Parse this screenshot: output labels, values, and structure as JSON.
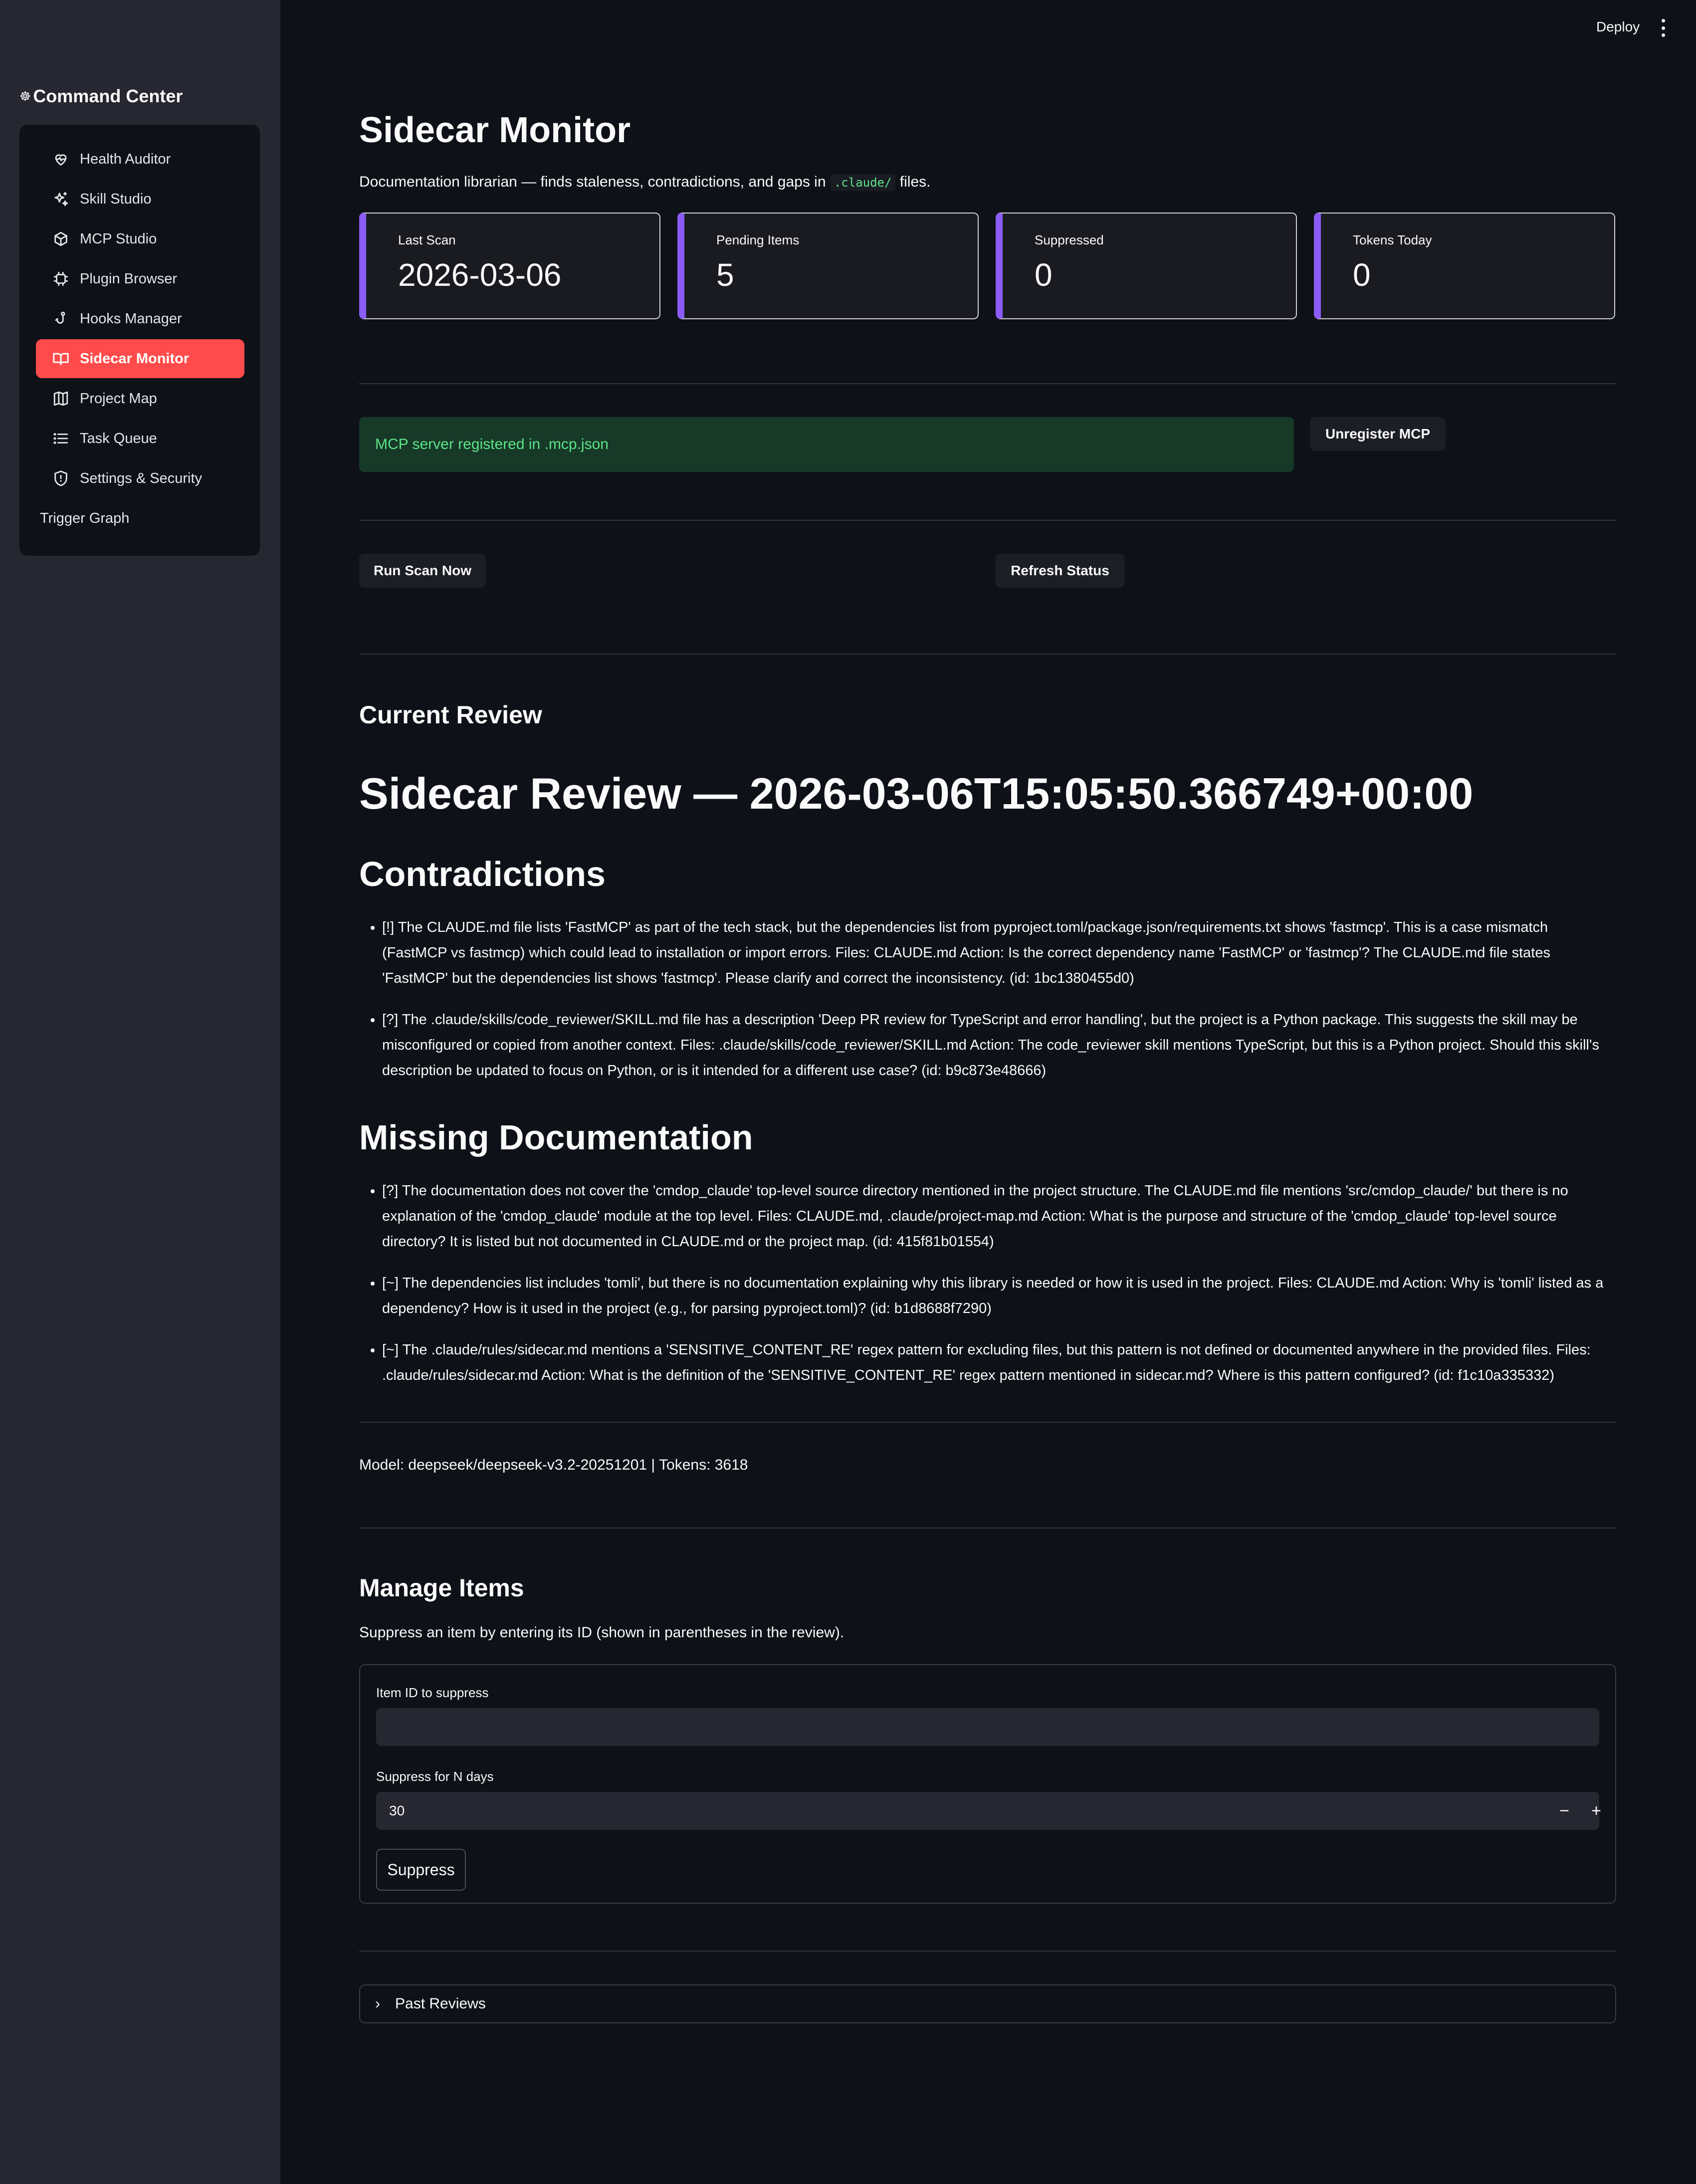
{
  "sidebar": {
    "brand": "Command Center",
    "brand_icon": "steering-icon",
    "items": [
      {
        "label": "Health Auditor",
        "icon": "heart-pulse-icon"
      },
      {
        "label": "Skill Studio",
        "icon": "sparkles-icon"
      },
      {
        "label": "MCP Studio",
        "icon": "box-icon"
      },
      {
        "label": "Plugin Browser",
        "icon": "puzzle-icon"
      },
      {
        "label": "Hooks Manager",
        "icon": "hook-icon"
      },
      {
        "label": "Sidecar Monitor",
        "icon": "book-open-icon",
        "active": true
      },
      {
        "label": "Project Map",
        "icon": "map-icon"
      },
      {
        "label": "Task Queue",
        "icon": "list-icon"
      },
      {
        "label": "Settings & Security",
        "icon": "shield-icon"
      },
      {
        "label": "Trigger Graph",
        "icon": ""
      }
    ]
  },
  "header": {
    "deploy": "Deploy",
    "menu_icon": "kebab-menu-icon"
  },
  "page": {
    "title": "Sidecar Monitor",
    "subtitle_before": "Documentation librarian — finds staleness, contradictions, and gaps in",
    "subtitle_code": ".claude/",
    "subtitle_after": "files."
  },
  "metrics": [
    {
      "label": "Last Scan",
      "value": "2026-03-06"
    },
    {
      "label": "Pending Items",
      "value": "5"
    },
    {
      "label": "Suppressed",
      "value": "0"
    },
    {
      "label": "Tokens Today",
      "value": "0"
    }
  ],
  "mcp": {
    "status": "MCP server registered in .mcp.json",
    "unregister_label": "Unregister MCP"
  },
  "actions": {
    "run_scan": "Run Scan Now",
    "refresh": "Refresh Status"
  },
  "review": {
    "section_title": "Current Review",
    "heading": "Sidecar Review — 2026-03-06T15:05:50.366749+00:00",
    "contradictions_title": "Contradictions",
    "contradictions": [
      "[!] The CLAUDE.md file lists 'FastMCP' as part of the tech stack, but the dependencies list from pyproject.toml/package.json/requirements.txt shows 'fastmcp'. This is a case mismatch (FastMCP vs fastmcp) which could lead to installation or import errors. Files: CLAUDE.md Action: Is the correct dependency name 'FastMCP' or 'fastmcp'? The CLAUDE.md file states 'FastMCP' but the dependencies list shows 'fastmcp'. Please clarify and correct the inconsistency. (id: 1bc1380455d0)",
      "[?] The .claude/skills/code_reviewer/SKILL.md file has a description 'Deep PR review for TypeScript and error handling', but the project is a Python package. This suggests the skill may be misconfigured or copied from another context. Files: .claude/skills/code_reviewer/SKILL.md Action: The code_reviewer skill mentions TypeScript, but this is a Python project. Should this skill's description be updated to focus on Python, or is it intended for a different use case? (id: b9c873e48666)"
    ],
    "missing_title": "Missing Documentation",
    "missing": [
      "[?] The documentation does not cover the 'cmdop_claude' top-level source directory mentioned in the project structure. The CLAUDE.md file mentions 'src/cmdop_claude/' but there is no explanation of the 'cmdop_claude' module at the top level. Files: CLAUDE.md, .claude/project-map.md Action: What is the purpose and structure of the 'cmdop_claude' top-level source directory? It is listed but not documented in CLAUDE.md or the project map. (id: 415f81b01554)",
      "[~] The dependencies list includes 'tomli', but there is no documentation explaining why this library is needed or how it is used in the project. Files: CLAUDE.md Action: Why is 'tomli' listed as a dependency? How is it used in the project (e.g., for parsing pyproject.toml)? (id: b1d8688f7290)",
      "[~] The .claude/rules/sidecar.md mentions a 'SENSITIVE_CONTENT_RE' regex pattern for excluding files, but this pattern is not defined or documented anywhere in the provided files. Files: .claude/rules/sidecar.md Action: What is the definition of the 'SENSITIVE_CONTENT_RE' regex pattern mentioned in sidecar.md? Where is this pattern configured? (id: f1c10a335332)"
    ],
    "footer": "Model: deepseek/deepseek-v3.2-20251201 | Tokens: 3618"
  },
  "manage": {
    "title": "Manage Items",
    "hint": "Suppress an item by entering its ID (shown in parentheses in the review).",
    "item_id_label": "Item ID to suppress",
    "item_id_value": "",
    "days_label": "Suppress for N days",
    "days_value": "30",
    "minus": "−",
    "plus": "+",
    "suppress_label": "Suppress"
  },
  "past": {
    "label": "Past Reviews",
    "chevron": "chevron-right-icon"
  },
  "colors": {
    "accent": "#ff4b4b",
    "metric_bar": "#8b5cf6",
    "success_text": "#5ce488",
    "background": "#0e1117",
    "sidebar": "#262730"
  }
}
